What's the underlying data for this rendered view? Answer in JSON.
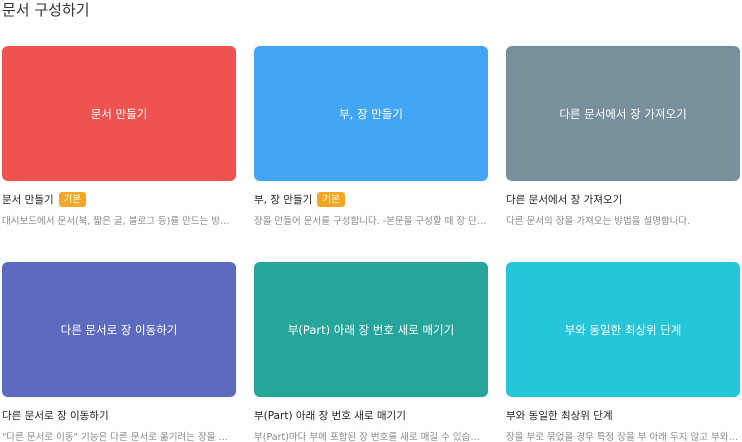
{
  "section": {
    "title": "문서 구성하기"
  },
  "cards": [
    {
      "thumb_label": "문서 만들기",
      "color": "#ef5350",
      "title": "문서 만들기",
      "badge": "기본",
      "desc": "대시보드에서 문서(북, 짧은 글, 블로그 등)를 만드는 방법을 설명합니다."
    },
    {
      "thumb_label": "부, 장 만들기",
      "color": "#42a5f5",
      "title": "부, 장 만들기",
      "badge": "기본",
      "desc": "장을 만들어 문서를 구성합니다. -본문을 구성할 때 장 단위로 구성합니다."
    },
    {
      "thumb_label": "다른 문서에서 장 가져오기",
      "color": "#78909c",
      "title": "다른 문서에서 장 가져오기",
      "badge": "",
      "desc": "다른 문서의 장을 가져오는 방법을 설명합니다."
    },
    {
      "thumb_label": "다른 문서로 장 이동하기",
      "color": "#5c6bc0",
      "title": "다른 문서로 장 이동하기",
      "badge": "",
      "desc": "\"다른 문서로 이동\" 기능은 다른 문서로 옮기려는 장을 이동합니다."
    },
    {
      "thumb_label": "부(Part) 아래 장 번호 새로 매기기",
      "color": "#26a69a",
      "title": "부(Part) 아래 장 번호 새로 매기기",
      "badge": "",
      "desc": "부(Part)마다 부에 포함된 장 번호를 새로 매길 수 있습니다."
    },
    {
      "thumb_label": "부와 동일한 최상위 단계",
      "color": "#26c6da",
      "title": "부와 동일한 최상위 단계",
      "badge": "",
      "desc": "장을 부로 묶었을 경우 특정 장을 부 아래 두지 않고 부와 동일한 단계로 둡니다."
    }
  ]
}
